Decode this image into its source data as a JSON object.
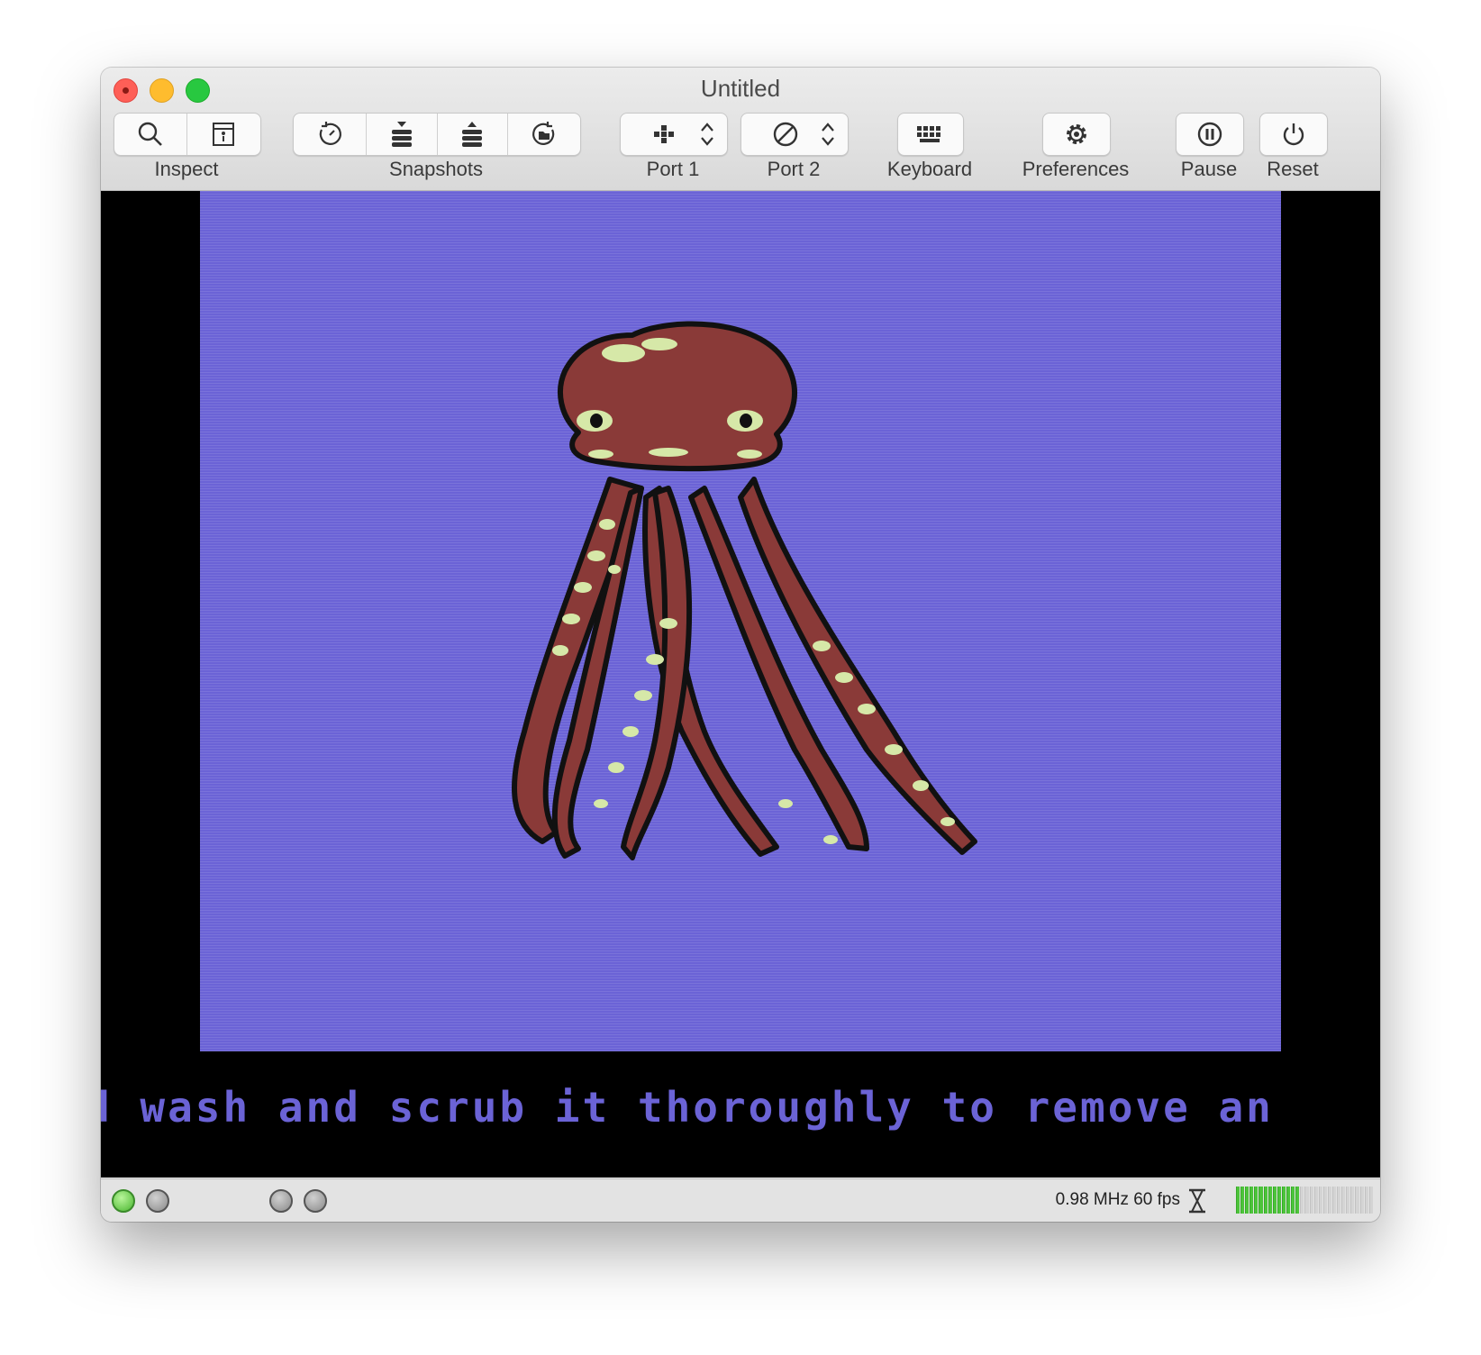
{
  "window": {
    "title": "Untitled"
  },
  "toolbar": {
    "inspect": {
      "label": "Inspect",
      "icons": [
        "magnifier-icon",
        "inspector-panel-icon"
      ]
    },
    "snapshots": {
      "label": "Snapshots",
      "icons": [
        "snapshot-clock-icon",
        "take-snapshot-icon",
        "restore-snapshot-icon",
        "snapshot-browser-icon"
      ]
    },
    "port1": {
      "label": "Port 1",
      "icon": "joystick-icon"
    },
    "port2": {
      "label": "Port 2",
      "icon": "none-icon"
    },
    "keyboard": {
      "label": "Keyboard",
      "icon": "keyboard-icon"
    },
    "preferences": {
      "label": "Preferences",
      "icon": "gear-icon"
    },
    "pause": {
      "label": "Pause",
      "icon": "pause-icon"
    },
    "reset": {
      "label": "Reset",
      "icon": "power-icon"
    }
  },
  "emulator": {
    "scroll_text": "d wash and scrub it thoroughly to remove an",
    "colors": {
      "screen": "#6b63d6",
      "border": "#000000",
      "octopus": "#8a3a38",
      "spots": "#d6e8a8",
      "text": "#6b63d6"
    }
  },
  "statusbar": {
    "speed": "0.98 MHz 60 fps",
    "leds": [
      {
        "name": "power-led",
        "state": "on"
      },
      {
        "name": "drive8-led",
        "state": "off"
      },
      {
        "name": "drive-led-3",
        "state": "off"
      },
      {
        "name": "drive-led-4",
        "state": "off"
      }
    ],
    "activity_level": 0.47
  }
}
